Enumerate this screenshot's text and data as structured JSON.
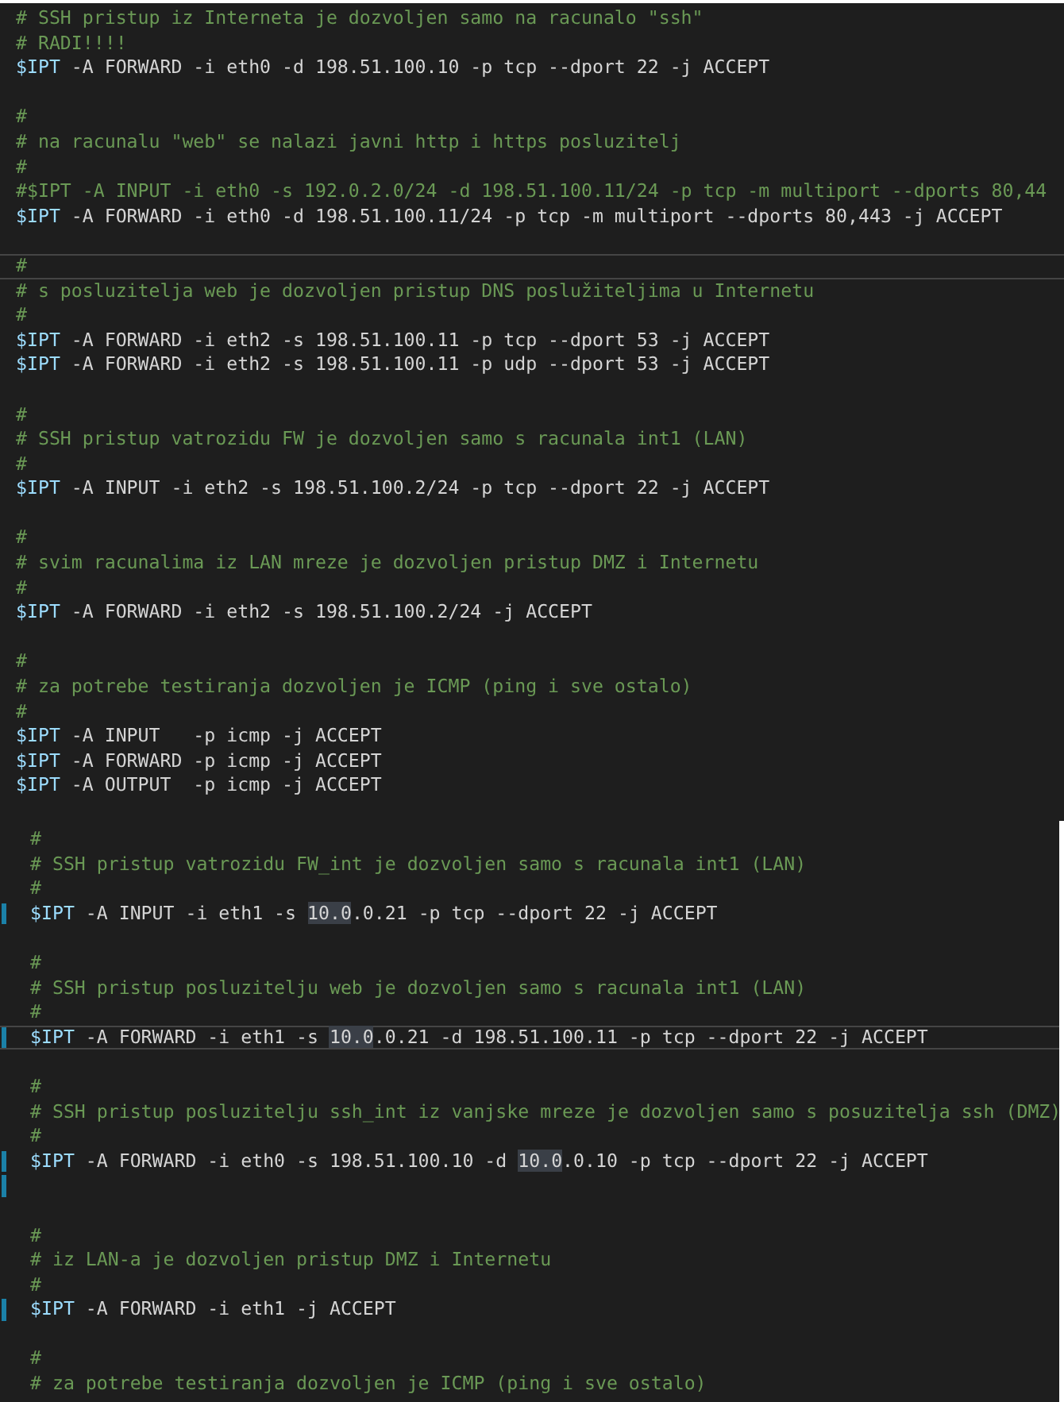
{
  "panels": [
    {
      "lines": [
        {
          "kind": "comment",
          "text": "# SSH pristup iz Interneta je dozvoljen samo na racunalo \"ssh\"",
          "current": false,
          "modified": false
        },
        {
          "kind": "comment",
          "text": "# RADI!!!!",
          "current": false,
          "modified": false
        },
        {
          "kind": "command",
          "segments": [
            {
              "kind": "variable",
              "text": "$IPT"
            },
            {
              "kind": "plain",
              "text": " -A FORWARD -i eth0 -d 198.51.100.10 -p tcp --dport 22 -j ACCEPT"
            }
          ],
          "current": false,
          "modified": false
        },
        {
          "kind": "blank",
          "current": false,
          "modified": false
        },
        {
          "kind": "comment",
          "text": "#",
          "current": false,
          "modified": false
        },
        {
          "kind": "comment",
          "text": "# na racunalu \"web\" se nalazi javni http i https posluzitelj",
          "current": false,
          "modified": false
        },
        {
          "kind": "comment",
          "text": "#",
          "current": false,
          "modified": false
        },
        {
          "kind": "comment",
          "text": "#$IPT -A INPUT -i eth0 -s 192.0.2.0/24 -d 198.51.100.11/24 -p tcp -m multiport --dports 80,44",
          "current": false,
          "modified": false
        },
        {
          "kind": "command",
          "segments": [
            {
              "kind": "variable",
              "text": "$IPT"
            },
            {
              "kind": "plain",
              "text": " -A FORWARD -i eth0 -d 198.51.100.11/24 -p tcp -m multiport --dports 80,443 -j ACCEPT"
            }
          ],
          "current": false,
          "modified": false
        },
        {
          "kind": "blank",
          "current": false,
          "modified": false
        },
        {
          "kind": "comment",
          "text": "#",
          "current": true,
          "modified": false
        },
        {
          "kind": "comment",
          "text": "# s posluzitelja web je dozvoljen pristup DNS poslužiteljima u Internetu",
          "current": false,
          "modified": false
        },
        {
          "kind": "comment",
          "text": "#",
          "current": false,
          "modified": false
        },
        {
          "kind": "command",
          "segments": [
            {
              "kind": "variable",
              "text": "$IPT"
            },
            {
              "kind": "plain",
              "text": " -A FORWARD -i eth2 -s 198.51.100.11 -p tcp --dport 53 -j ACCEPT"
            }
          ],
          "current": false,
          "modified": false
        },
        {
          "kind": "command",
          "segments": [
            {
              "kind": "variable",
              "text": "$IPT"
            },
            {
              "kind": "plain",
              "text": " -A FORWARD -i eth2 -s 198.51.100.11 -p udp --dport 53 -j ACCEPT"
            }
          ],
          "current": false,
          "modified": false
        },
        {
          "kind": "blank",
          "current": false,
          "modified": false
        },
        {
          "kind": "comment",
          "text": "#",
          "current": false,
          "modified": false
        },
        {
          "kind": "comment",
          "text": "# SSH pristup vatrozidu FW je dozvoljen samo s racunala int1 (LAN)",
          "current": false,
          "modified": false
        },
        {
          "kind": "comment",
          "text": "#",
          "current": false,
          "modified": false
        },
        {
          "kind": "command",
          "segments": [
            {
              "kind": "variable",
              "text": "$IPT"
            },
            {
              "kind": "plain",
              "text": " -A INPUT -i eth2 -s 198.51.100.2/24 -p tcp --dport 22 -j ACCEPT"
            }
          ],
          "current": false,
          "modified": false
        },
        {
          "kind": "blank",
          "current": false,
          "modified": false
        },
        {
          "kind": "comment",
          "text": "#",
          "current": false,
          "modified": false
        },
        {
          "kind": "comment",
          "text": "# svim racunalima iz LAN mreze je dozvoljen pristup DMZ i Internetu",
          "current": false,
          "modified": false
        },
        {
          "kind": "comment",
          "text": "#",
          "current": false,
          "modified": false
        },
        {
          "kind": "command",
          "segments": [
            {
              "kind": "variable",
              "text": "$IPT"
            },
            {
              "kind": "plain",
              "text": " -A FORWARD -i eth2 -s 198.51.100.2/24 -j ACCEPT"
            }
          ],
          "current": false,
          "modified": false
        },
        {
          "kind": "blank",
          "current": false,
          "modified": false
        },
        {
          "kind": "comment",
          "text": "#",
          "current": false,
          "modified": false
        },
        {
          "kind": "comment",
          "text": "# za potrebe testiranja dozvoljen je ICMP (ping i sve ostalo)",
          "current": false,
          "modified": false
        },
        {
          "kind": "comment",
          "text": "#",
          "current": false,
          "modified": false
        },
        {
          "kind": "command",
          "segments": [
            {
              "kind": "variable",
              "text": "$IPT"
            },
            {
              "kind": "plain",
              "text": " -A INPUT   -p icmp -j ACCEPT"
            }
          ],
          "current": false,
          "modified": false
        },
        {
          "kind": "command",
          "segments": [
            {
              "kind": "variable",
              "text": "$IPT"
            },
            {
              "kind": "plain",
              "text": " -A FORWARD -p icmp -j ACCEPT"
            }
          ],
          "current": false,
          "modified": false
        },
        {
          "kind": "command",
          "segments": [
            {
              "kind": "variable",
              "text": "$IPT"
            },
            {
              "kind": "plain",
              "text": " -A OUTPUT  -p icmp -j ACCEPT"
            }
          ],
          "current": false,
          "modified": false
        }
      ]
    },
    {
      "lines": [
        {
          "kind": "comment",
          "text": "#",
          "current": false,
          "modified": false
        },
        {
          "kind": "comment",
          "text": "# SSH pristup vatrozidu FW_int je dozvoljen samo s racunala int1 (LAN)",
          "current": false,
          "modified": false
        },
        {
          "kind": "comment",
          "text": "#",
          "current": false,
          "modified": false
        },
        {
          "kind": "command",
          "segments": [
            {
              "kind": "variable",
              "text": "$IPT"
            },
            {
              "kind": "plain",
              "text": " -A INPUT -i eth1 -s "
            },
            {
              "kind": "match",
              "text": "10.0"
            },
            {
              "kind": "plain",
              "text": ".0.21 -p tcp --dport 22 -j ACCEPT"
            }
          ],
          "current": false,
          "modified": true
        },
        {
          "kind": "blank",
          "current": false,
          "modified": false
        },
        {
          "kind": "comment",
          "text": "#",
          "current": false,
          "modified": false
        },
        {
          "kind": "comment",
          "text": "# SSH pristup posluzitelju web je dozvoljen samo s racunala int1 (LAN)",
          "current": false,
          "modified": false
        },
        {
          "kind": "comment",
          "text": "#",
          "current": false,
          "modified": false
        },
        {
          "kind": "command",
          "segments": [
            {
              "kind": "variable",
              "text": "$IPT"
            },
            {
              "kind": "plain",
              "text": " -A FORWARD -i eth1 -s "
            },
            {
              "kind": "match",
              "text": "10.0"
            },
            {
              "kind": "plain",
              "text": ".0.21 -d 198.51.100.11 -p tcp --dport 22 -j ACCEPT"
            }
          ],
          "current": true,
          "modified": true
        },
        {
          "kind": "blank",
          "current": false,
          "modified": false
        },
        {
          "kind": "comment",
          "text": "#",
          "current": false,
          "modified": false
        },
        {
          "kind": "comment",
          "text": "# SSH pristup posluzitelju ssh_int iz vanjske mreze je dozvoljen samo s posuzitelja ssh (DMZ)",
          "current": false,
          "modified": false
        },
        {
          "kind": "comment",
          "text": "#",
          "current": false,
          "modified": false
        },
        {
          "kind": "command",
          "segments": [
            {
              "kind": "variable",
              "text": "$IPT"
            },
            {
              "kind": "plain",
              "text": " -A FORWARD -i eth0 -s 198.51.100.10 -d "
            },
            {
              "kind": "match",
              "text": "10.0"
            },
            {
              "kind": "plain",
              "text": ".0.10 -p tcp --dport 22 -j ACCEPT"
            }
          ],
          "current": false,
          "modified": true
        },
        {
          "kind": "blank",
          "current": false,
          "modified": true
        },
        {
          "kind": "blank",
          "current": false,
          "modified": false
        },
        {
          "kind": "comment",
          "text": "#",
          "current": false,
          "modified": false
        },
        {
          "kind": "comment",
          "text": "# iz LAN-a je dozvoljen pristup DMZ i Internetu",
          "current": false,
          "modified": false
        },
        {
          "kind": "comment",
          "text": "#",
          "current": false,
          "modified": false
        },
        {
          "kind": "command",
          "segments": [
            {
              "kind": "variable",
              "text": "$IPT"
            },
            {
              "kind": "plain",
              "text": " -A FORWARD -i eth1 -j ACCEPT"
            }
          ],
          "current": false,
          "modified": true
        },
        {
          "kind": "blank",
          "current": false,
          "modified": false
        },
        {
          "kind": "comment",
          "text": "#",
          "current": false,
          "modified": false
        },
        {
          "kind": "comment",
          "text": "# za potrebe testiranja dozvoljen je ICMP (ping i sve ostalo)",
          "current": false,
          "modified": false
        }
      ]
    }
  ]
}
